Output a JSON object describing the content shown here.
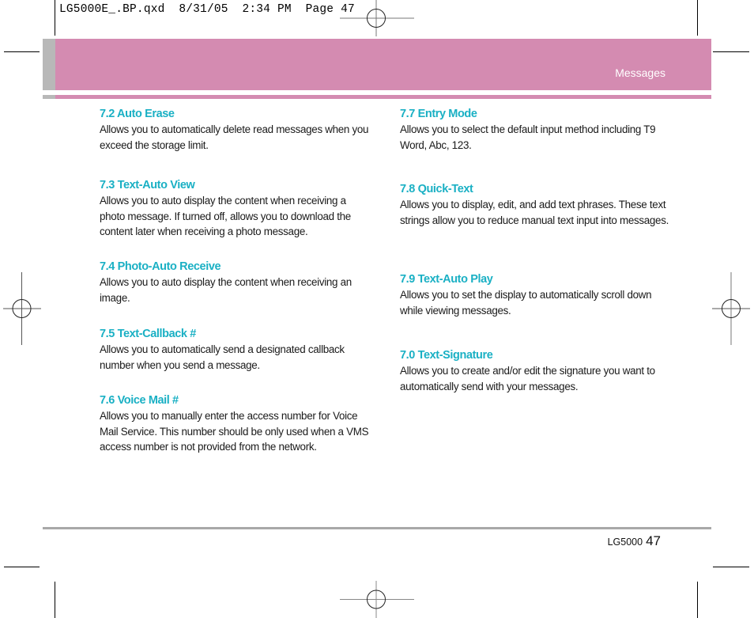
{
  "slug": {
    "filename": "LG5000E_.BP.qxd",
    "date": "8/31/05",
    "time": "2:34 PM",
    "page_label": "Page 47"
  },
  "header": {
    "section_title": "Messages",
    "band_color": "#d48bb1",
    "tab_color": "#b8b8b8"
  },
  "columns": {
    "left": [
      {
        "heading": "7.2 Auto Erase",
        "body": "Allows you to automatically delete read messages when you exceed the storage limit."
      },
      {
        "heading": "7.3 Text-Auto View",
        "body": "Allows you to auto display the content when receiving a photo message. If turned off, allows you to download the content later when receiving a photo message."
      },
      {
        "heading": "7.4 Photo-Auto Receive",
        "body": "Allows you to auto display the content when receiving an image."
      },
      {
        "heading": "7.5 Text-Callback #",
        "body": "Allows you to automatically send a designated callback number when you send a message."
      },
      {
        "heading": "7.6 Voice Mail #",
        "body": "Allows you to manually enter the access number for Voice Mail Service. This number should be only used when a VMS access number is not provided from the network."
      }
    ],
    "right": [
      {
        "heading": "7.7 Entry Mode",
        "body": "Allows you to select the default input method including T9 Word, Abc, 123."
      },
      {
        "heading": "7.8 Quick-Text",
        "body": "Allows you to display, edit, and add text phrases. These text strings allow you to reduce manual text input into messages."
      },
      {
        "heading": "7.9 Text-Auto Play",
        "body": "Allows you to set the display to automatically scroll down while viewing messages."
      },
      {
        "heading": "7.0 Text-Signature",
        "body": "Allows you to create and/or edit the signature you want to automatically send with your messages."
      }
    ]
  },
  "footer": {
    "model": "LG5000",
    "page_number": "47"
  },
  "colors": {
    "heading": "#1ab0c4",
    "body_text": "#1a1a1a",
    "footer_rule": "#a8a8a8"
  }
}
